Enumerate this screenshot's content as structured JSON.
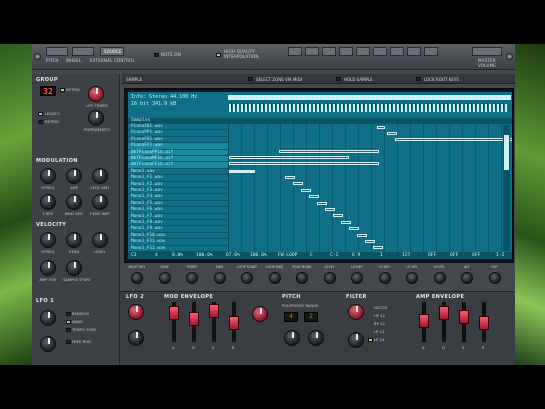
{
  "top_strip": {
    "left_labels": [
      "PITCH",
      "WHEEL",
      "EXTERNAL CONTROL"
    ],
    "source": "SOURCE",
    "note_on": "NOTE ON",
    "quality": "HIGH QUALITY INTERPOLATION",
    "master": "MASTER VOLUME",
    "small": [
      "ANTI-",
      "IT",
      "PITCH",
      "VIEW",
      "SAMPLE",
      "LOOP",
      "VOLUME",
      "TRIANGLE",
      "MAIN"
    ]
  },
  "sample_bar": {
    "title": "SAMPLE",
    "select_by_midi": "SELECT ZONE VIA MIDI",
    "hold": "HOLD SAMPLE",
    "lock": "LOCK ROOT KEYS"
  },
  "left": {
    "group": "GROUP",
    "group_value": "32",
    "group_opts": [
      "RETRIG",
      "LEGATO"
    ],
    "legato": "LEGATO",
    "retrig": "RETRIG",
    "lfo_tempo": "LFO TEMPO",
    "portamento": "PORTAMENTO",
    "modulation": "MODULATION",
    "mod_labels": [
      "F.FREQ",
      "AMP",
      "LFO1 AMT",
      "F.RES",
      "MOD AMT",
      "F.ENV AMT"
    ],
    "velocity": "VELOCITY",
    "vel_labels": [
      "F.FREQ",
      "F.ENV",
      "LEVEL",
      "AMP ENV",
      "SAMPLE",
      "SAMPLE START",
      "LFO 1"
    ]
  },
  "lcd": {
    "info_line1": "Info: Stereo 44.100 Hz",
    "info_line2": "16 bit 341.9 kB",
    "header": "Samples",
    "rows": [
      "PianoX01.wav",
      "PianoPP1.wav",
      "PianoF01.wav",
      "PianoFF1.wav",
      "BKTPianoPP1b.aif",
      "BKTPianoMF1b.aif",
      "BKTPianoFF1b.aif",
      "Mono1.wav",
      "Mono1_F1.wav",
      "Mono1_F2.wav",
      "Mono1_F3.wav",
      "Mono1_F4.wav",
      "Mono1_F5.wav",
      "Mono1_F6.wav",
      "Mono1_F7.wav",
      "Mono1_F8.wav",
      "Mono1_F9.wav",
      "Mono1_F10.wav",
      "Mono1_F11.wav",
      "Mono1_F12.wav"
    ],
    "params": [
      "C3",
      "4",
      "0.0%",
      "100.0%",
      "67.0%",
      "100.0%",
      "FW-LOOP",
      "C",
      "C-1",
      "G 9",
      "1",
      "127",
      "OFF",
      "OFF",
      "OFF",
      "1-2"
    ]
  },
  "knob_labels": [
    "ROOT KEY",
    "TUNE",
    "START",
    "END",
    "LOOP START",
    "LOOP END",
    "PLAY MODE",
    "LEVEL",
    "LO KEY",
    "HI KEY",
    "LO VEL",
    "HI VEL",
    "ALT",
    "OUT"
  ],
  "lower": {
    "lfo2": "LFO 2",
    "mod_env": "MOD ENVELOPE",
    "pitch": "PITCH",
    "pitch_range": "POLYPHONY RANGE",
    "poly": "4",
    "range": "2",
    "filter": "FILTER",
    "amp_env": "AMP ENVELOPE",
    "lfo1": "LFO 1",
    "env_labels": [
      "A",
      "D",
      "S",
      "R"
    ],
    "lfo1_opts": [
      "RANDOM",
      "WAVE",
      "TEMPO SYNC",
      "FREE RUN"
    ],
    "filter_types": [
      "NOTCH",
      "HP 12",
      "BP 12",
      "LP 12",
      "LP 24"
    ],
    "amt": "AMT",
    "freq": "FREQ",
    "res": "RES",
    "invert": "INVERT"
  }
}
